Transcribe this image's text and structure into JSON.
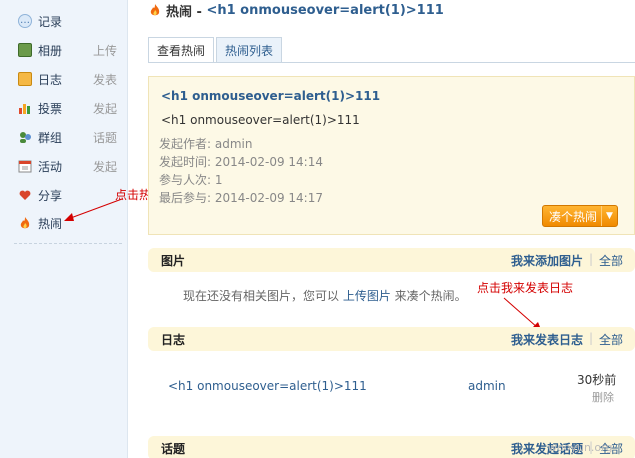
{
  "sidebar": {
    "items": [
      {
        "label": "记录",
        "sub": "",
        "icon": "speech-bubble-icon"
      },
      {
        "label": "相册",
        "sub": "上传",
        "icon": "photo-icon"
      },
      {
        "label": "日志",
        "sub": "发表",
        "icon": "notebook-icon"
      },
      {
        "label": "投票",
        "sub": "发起",
        "icon": "bar-chart-icon"
      },
      {
        "label": "群组",
        "sub": "话题",
        "icon": "group-icon"
      },
      {
        "label": "活动",
        "sub": "发起",
        "icon": "calendar-icon"
      },
      {
        "label": "分享",
        "sub": "",
        "icon": "heart-icon"
      },
      {
        "label": "热闹",
        "sub": "",
        "icon": "flame-icon"
      }
    ]
  },
  "annotations": {
    "click_hot": "点击热闹",
    "click_publish": "点击我来发表日志"
  },
  "header": {
    "prefix": "热闹 - ",
    "title": "<h1 onmouseover=alert(1)>111"
  },
  "tabs": [
    {
      "label": "查看热闹",
      "active": true
    },
    {
      "label": "热闹列表",
      "active": false
    }
  ],
  "event": {
    "title": "<h1 onmouseover=alert(1)>111",
    "description": "<h1 onmouseover=alert(1)>111",
    "initiator": "发起作者: admin",
    "start_time": "发起时间: 2014-02-09 14:14",
    "participants": "参与人次: 1",
    "last_participation": "最后参与: 2014-02-09 14:17",
    "join_button": "凑个热闹"
  },
  "sections": {
    "images": {
      "title": "图片",
      "action": "我来添加图片",
      "all": "全部",
      "empty_prefix": "现在还没有相关图片，您可以 ",
      "empty_link": "上传图片",
      "empty_suffix": " 来凑个热闹。"
    },
    "logs": {
      "title": "日志",
      "action": "我来发表日志",
      "all": "全部",
      "entries": [
        {
          "title": "<h1 onmouseover=alert(1)>111",
          "author": "admin",
          "time": "30秒前",
          "delete": "删除"
        }
      ]
    },
    "topics": {
      "title": "话题",
      "action": "我来发起话题",
      "all": "全部"
    }
  },
  "watermark": "wooyun.org",
  "colors": {
    "link": "#2e5e8f",
    "annotation": "#d40000",
    "section_bg": "#fdf6d9",
    "button": "#f08a00"
  }
}
